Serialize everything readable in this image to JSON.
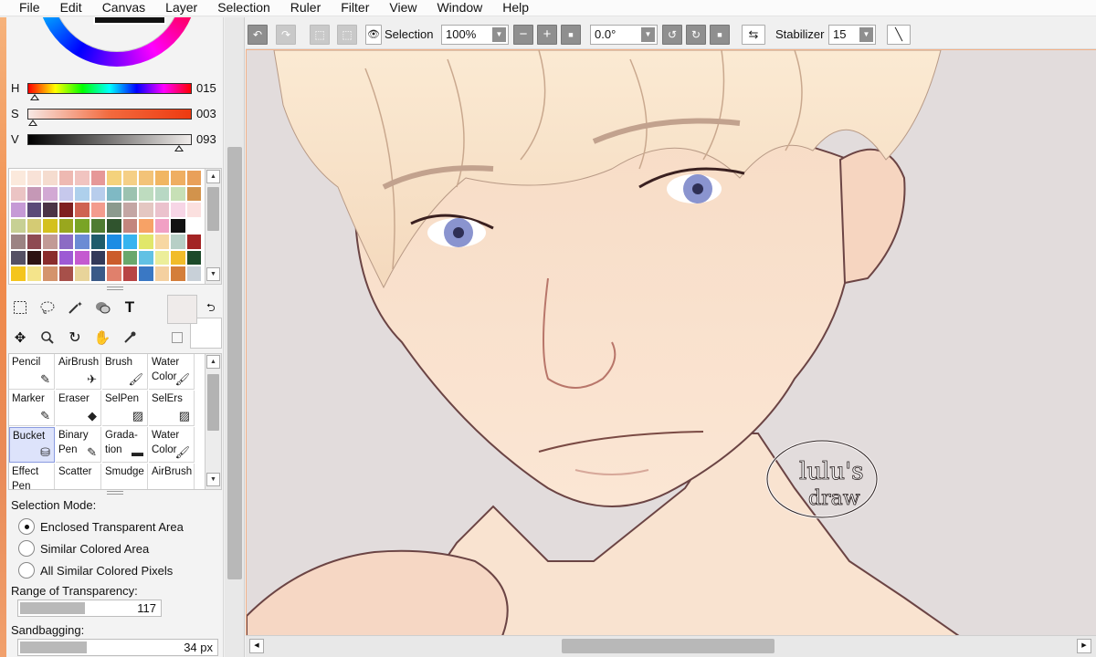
{
  "menu": [
    "File",
    "Edit",
    "Canvas",
    "Layer",
    "Selection",
    "Ruler",
    "Filter",
    "View",
    "Window",
    "Help"
  ],
  "hsv": {
    "h_label": "H",
    "h_value": "015",
    "s_label": "S",
    "s_value": "003",
    "v_label": "V",
    "v_value": "093"
  },
  "swatches": [
    "#fbe9dc",
    "#f8e2d7",
    "#f5dccf",
    "#eeb9b2",
    "#f1c4c0",
    "#e69898",
    "#f4d27c",
    "#f5cf86",
    "#f3c378",
    "#f1b662",
    "#efae62",
    "#e9a05a",
    "#ebc4c4",
    "#c598b6",
    "#d2a9d4",
    "#c6c8ec",
    "#aed0ec",
    "#b8cdec",
    "#7fb9c4",
    "#9cc2b0",
    "#bedcbf",
    "#b8d8c4",
    "#c7e0b6",
    "#d2934c",
    "#c69ad6",
    "#5b4a78",
    "#4b3346",
    "#7f2020",
    "#cf6352",
    "#f39c8e",
    "#8c9a8e",
    "#c4a6a4",
    "#e4c7c2",
    "#ebc2cd",
    "#f7d6e6",
    "#fbe0df",
    "#c7d094",
    "#d4cb74",
    "#d4c11e",
    "#99a71e",
    "#79a426",
    "#4f7c32",
    "#30542e",
    "#c3857d",
    "#f7a266",
    "#f1a0c4",
    "#111111",
    "#ffffff",
    "#9c8383",
    "#8e4a53",
    "#c29a96",
    "#8c6bc4",
    "#6b8bd4",
    "#1f5c6c",
    "#1c8ce4",
    "#36b4ef",
    "#e1e76a",
    "#f7d7a2",
    "#b7cfc6",
    "#a32424",
    "#555064",
    "#2d1313",
    "#8a2d2d",
    "#9d5ad4",
    "#c45ad0",
    "#333a5a",
    "#cb5c2c",
    "#69a86c",
    "#61c1e4",
    "#ecee9a",
    "#f1bc2a",
    "#1c4a2a",
    "#f4c51d",
    "#f4e48b",
    "#d4946c",
    "#a7504a",
    "#e8d49a",
    "#3a5a88",
    "#e0806c",
    "#b84444",
    "#3a78c4",
    "#f4d0a0",
    "#d47e3a",
    "#c8d0d8"
  ],
  "brushes": [
    {
      "name": "Pencil",
      "icon": "pencil-icon",
      "glyph": "✎"
    },
    {
      "name": "AirBrush",
      "icon": "airbrush-icon",
      "glyph": "✈"
    },
    {
      "name": "Brush",
      "icon": "brush-icon",
      "glyph": "🖌"
    },
    {
      "name": "Water\nColor",
      "icon": "watercolor-icon",
      "glyph": "🖌"
    },
    {
      "name": "Marker",
      "icon": "marker-icon",
      "glyph": "✎"
    },
    {
      "name": "Eraser",
      "icon": "eraser-icon",
      "glyph": "◆"
    },
    {
      "name": "SelPen",
      "icon": "selpen-icon",
      "glyph": "▨"
    },
    {
      "name": "SelErs",
      "icon": "selers-icon",
      "glyph": "▨"
    },
    {
      "name": "Bucket",
      "icon": "bucket-icon",
      "glyph": "⛁"
    },
    {
      "name": "Binary\nPen",
      "icon": "binary-pen-icon",
      "glyph": "✎"
    },
    {
      "name": "Grada-\ntion",
      "icon": "gradation-icon",
      "glyph": "▬"
    },
    {
      "name": "Water\nColor",
      "icon": "watercolor-icon-2",
      "glyph": "🖌"
    },
    {
      "name": "Effect\nPen",
      "icon": "effect-pen-icon",
      "glyph": ""
    },
    {
      "name": "Scatter",
      "icon": "scatter-icon",
      "glyph": ""
    },
    {
      "name": "Smudge",
      "icon": "smudge-icon",
      "glyph": ""
    },
    {
      "name": "AirBrush",
      "icon": "airbrush-icon-2",
      "glyph": ""
    }
  ],
  "selected_brush": "Bucket",
  "options": {
    "selection_mode_label": "Selection Mode:",
    "modes": [
      "Enclosed Transparent Area",
      "Similar Colored Area",
      "All Similar Colored Pixels"
    ],
    "selected_mode": 0,
    "range_label": "Range of Transparency:",
    "range_value": "117",
    "range_fraction": 0.46,
    "sand_label": "Sandbagging:",
    "sand_value": "34 px",
    "sand_fraction": 0.34
  },
  "toolbar": {
    "selection_label": "Selection",
    "zoom": "100%",
    "rotation": "0.0°",
    "stabilizer_label": "Stabilizer",
    "stabilizer_value": "15"
  },
  "watermark": "lulu's draw",
  "colors": {
    "accent": "#f2b188",
    "selected_brush_bg": "#dde3fb",
    "canvas_bg": "#e0dcdc"
  }
}
